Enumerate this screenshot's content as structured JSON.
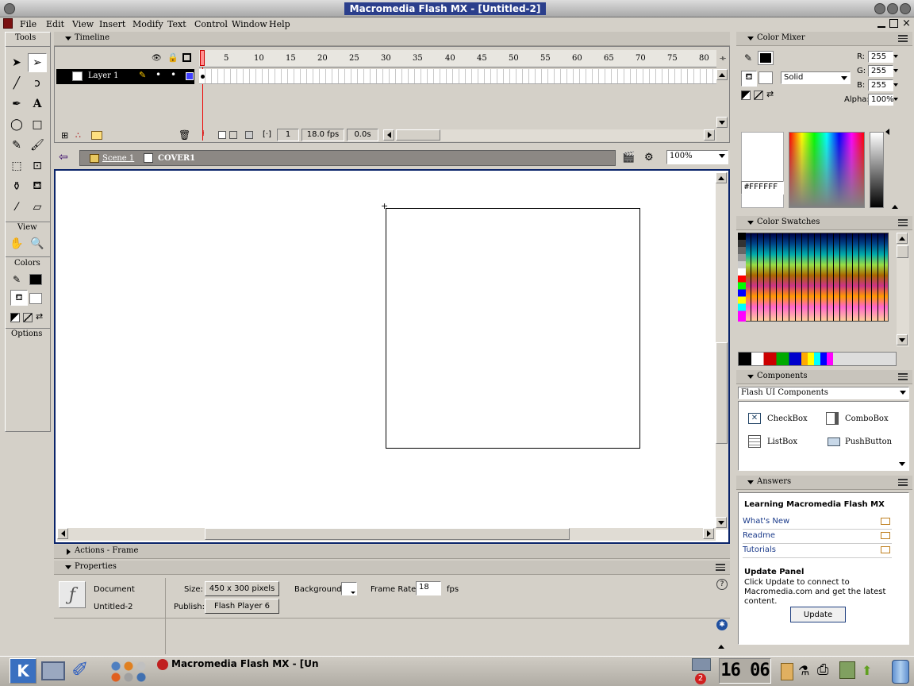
{
  "window": {
    "title": "Macromedia Flash MX - [Untitled-2]"
  },
  "menu": [
    "File",
    "Edit",
    "View",
    "Insert",
    "Modify",
    "Text",
    "Control",
    "Window",
    "Help"
  ],
  "tools_panel": {
    "title": "Tools",
    "view_label": "View",
    "colors_label": "Colors",
    "options_label": "Options"
  },
  "timeline": {
    "title": "Timeline",
    "layer_name": "Layer 1",
    "ruler_ticks": [
      "5",
      "10",
      "15",
      "20",
      "25",
      "30",
      "35",
      "40",
      "45",
      "50",
      "55",
      "60",
      "65",
      "70",
      "75",
      "80"
    ],
    "current_frame": "1",
    "fps": "18.0 fps",
    "time": "0.0s"
  },
  "scene_bar": {
    "scene": "Scene 1",
    "symbol": "COVER1",
    "zoom": "100%"
  },
  "panels": {
    "actions": "Actions - Frame",
    "properties": "Properties"
  },
  "properties": {
    "doc_label": "Document",
    "doc_name": "Untitled-2",
    "size_label": "Size:",
    "size_value": "450 x 300 pixels",
    "publish_label": "Publish:",
    "publish_value": "Flash Player 6",
    "background_label": "Background:",
    "frame_rate_label": "Frame Rate:",
    "frame_rate_value": "18",
    "fps_label": "fps"
  },
  "color_mixer": {
    "title": "Color Mixer",
    "fill_type": "Solid",
    "r_label": "R:",
    "r": "255",
    "g_label": "G:",
    "g": "255",
    "b_label": "B:",
    "b": "255",
    "alpha_label": "Alpha:",
    "alpha": "100%",
    "hex": "#FFFFFF"
  },
  "swatches": {
    "title": "Color Swatches"
  },
  "components": {
    "title": "Components",
    "set": "Flash UI Components",
    "items": [
      "CheckBox",
      "ComboBox",
      "ListBox",
      "PushButton"
    ]
  },
  "answers": {
    "title": "Answers",
    "heading": "Learning Macromedia Flash MX",
    "links": [
      "What's New",
      "Readme",
      "Tutorials"
    ],
    "update_heading": "Update Panel",
    "update_text": "Click Update to connect to Macromedia.com and get the latest content.",
    "update_button": "Update"
  },
  "taskbar": {
    "task": "Macromedia Flash MX - [Un",
    "clock": "16 06",
    "badge": "2"
  },
  "colors": {
    "titlebar": "#2b3f8c",
    "stage_border": "#0a246a",
    "taskbar": "#b8b4ac"
  }
}
